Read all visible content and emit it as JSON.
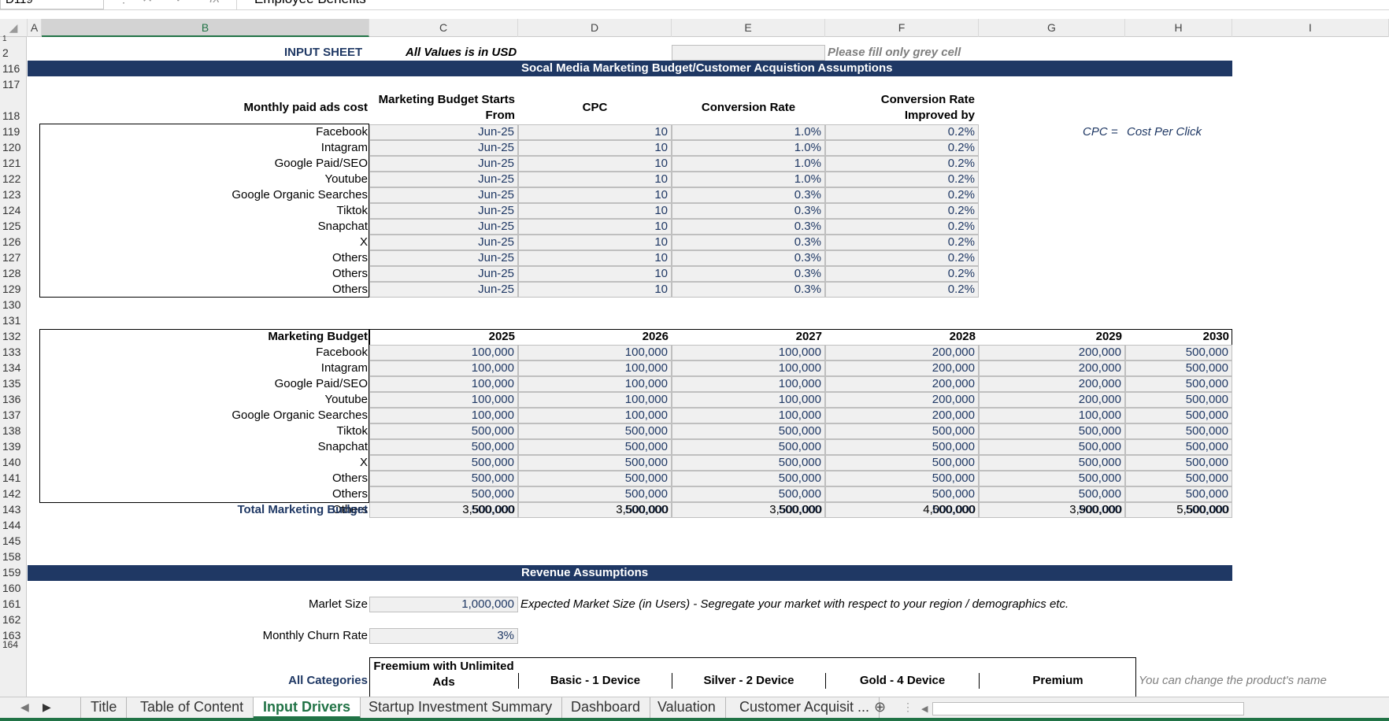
{
  "formula_bar": {
    "name_box": "D119",
    "fx": "fx",
    "content": "Employee Benefits"
  },
  "columns": [
    "A",
    "B",
    "C",
    "D",
    "E",
    "F",
    "G",
    "H",
    "I"
  ],
  "rows": [
    "1",
    "2",
    "116",
    "117",
    "118",
    "119",
    "120",
    "121",
    "122",
    "123",
    "124",
    "125",
    "126",
    "127",
    "128",
    "129",
    "130",
    "131",
    "132",
    "133",
    "134",
    "135",
    "136",
    "137",
    "138",
    "139",
    "140",
    "141",
    "142",
    "143",
    "144",
    "145",
    "158",
    "159",
    "160",
    "161",
    "162",
    "163",
    "164"
  ],
  "header": {
    "input_sheet": "INPUT SHEET",
    "values_note": "All Values is in USD",
    "fill_note": "Please fill only grey cell"
  },
  "banner1": "Socal Media Marketing Budget/Customer Acquistion Assumptions",
  "assumptions": {
    "headers": {
      "channel": "Monthly paid ads cost",
      "start": "Marketing Budget Starts",
      "start2": "From",
      "cpc": "CPC",
      "conv": "Conversion Rate",
      "improve": "Conversion Rate",
      "improve2": "Improved by"
    },
    "rows": [
      {
        "name": "Facebook",
        "start": "Jun-25",
        "cpc": "10",
        "conv": "1.0%",
        "imp": "0.2%"
      },
      {
        "name": "Intagram",
        "start": "Jun-25",
        "cpc": "10",
        "conv": "1.0%",
        "imp": "0.2%"
      },
      {
        "name": "Google Paid/SEO",
        "start": "Jun-25",
        "cpc": "10",
        "conv": "1.0%",
        "imp": "0.2%"
      },
      {
        "name": "Youtube",
        "start": "Jun-25",
        "cpc": "10",
        "conv": "1.0%",
        "imp": "0.2%"
      },
      {
        "name": "Google Organic Searches",
        "start": "Jun-25",
        "cpc": "10",
        "conv": "0.3%",
        "imp": "0.2%"
      },
      {
        "name": "Tiktok",
        "start": "Jun-25",
        "cpc": "10",
        "conv": "0.3%",
        "imp": "0.2%"
      },
      {
        "name": "Snapchat",
        "start": "Jun-25",
        "cpc": "10",
        "conv": "0.3%",
        "imp": "0.2%"
      },
      {
        "name": "X",
        "start": "Jun-25",
        "cpc": "10",
        "conv": "0.3%",
        "imp": "0.2%"
      },
      {
        "name": "Others",
        "start": "Jun-25",
        "cpc": "10",
        "conv": "0.3%",
        "imp": "0.2%"
      },
      {
        "name": "Others",
        "start": "Jun-25",
        "cpc": "10",
        "conv": "0.3%",
        "imp": "0.2%"
      },
      {
        "name": "Others",
        "start": "Jun-25",
        "cpc": "10",
        "conv": "0.3%",
        "imp": "0.2%"
      }
    ],
    "cpc_note_label": "CPC =",
    "cpc_note_value": "Cost Per Click"
  },
  "budget": {
    "title": "Marketing Budget",
    "years": [
      "2025",
      "2026",
      "2027",
      "2028",
      "2029",
      "2030"
    ],
    "rows": [
      {
        "name": "Facebook",
        "v": [
          "100,000",
          "100,000",
          "100,000",
          "200,000",
          "200,000",
          "500,000"
        ]
      },
      {
        "name": "Intagram",
        "v": [
          "100,000",
          "100,000",
          "100,000",
          "200,000",
          "200,000",
          "500,000"
        ]
      },
      {
        "name": "Google Paid/SEO",
        "v": [
          "100,000",
          "100,000",
          "100,000",
          "200,000",
          "200,000",
          "500,000"
        ]
      },
      {
        "name": "Youtube",
        "v": [
          "100,000",
          "100,000",
          "100,000",
          "200,000",
          "200,000",
          "500,000"
        ]
      },
      {
        "name": "Google Organic Searches",
        "v": [
          "100,000",
          "100,000",
          "100,000",
          "200,000",
          "100,000",
          "500,000"
        ]
      },
      {
        "name": "Tiktok",
        "v": [
          "500,000",
          "500,000",
          "500,000",
          "500,000",
          "500,000",
          "500,000"
        ]
      },
      {
        "name": "Snapchat",
        "v": [
          "500,000",
          "500,000",
          "500,000",
          "500,000",
          "500,000",
          "500,000"
        ]
      },
      {
        "name": "X",
        "v": [
          "500,000",
          "500,000",
          "500,000",
          "500,000",
          "500,000",
          "500,000"
        ]
      },
      {
        "name": "Others",
        "v": [
          "500,000",
          "500,000",
          "500,000",
          "500,000",
          "500,000",
          "500,000"
        ]
      },
      {
        "name": "Others",
        "v": [
          "500,000",
          "500,000",
          "500,000",
          "500,000",
          "500,000",
          "500,000"
        ]
      },
      {
        "name": "Others",
        "v": [
          "500,000",
          "500,000",
          "500,000",
          "500,000",
          "500,000",
          "500,000"
        ]
      }
    ],
    "total_label": "Total Marketing Budget",
    "totals": [
      "3,500,000",
      "3,500,000",
      "3,500,000",
      "4,000,000",
      "3,900,000",
      "5,500,000"
    ]
  },
  "banner2": "Revenue Assumptions",
  "revenue": {
    "market_label": "Marlet Size",
    "market_value": "1,000,000",
    "market_note": "Expected Market Size (in Users) - Segregate your market with respect to your region / demographics etc.",
    "churn_label": "Monthly Churn Rate",
    "churn_value": "3%",
    "categories_label": "All Categories",
    "products": [
      "Freemium with Unlimited Ads",
      "Basic - 1 Device",
      "Silver - 2 Device",
      "Gold - 4 Device",
      "Premium"
    ],
    "product_note": "You can change the product's name"
  },
  "tabs": [
    "Title",
    "Table of Content",
    "Input Drivers",
    "Startup Investment Summary",
    "Dashboard",
    "Valuation",
    "Customer Acquisit ..."
  ],
  "active_tab": "Input Drivers"
}
